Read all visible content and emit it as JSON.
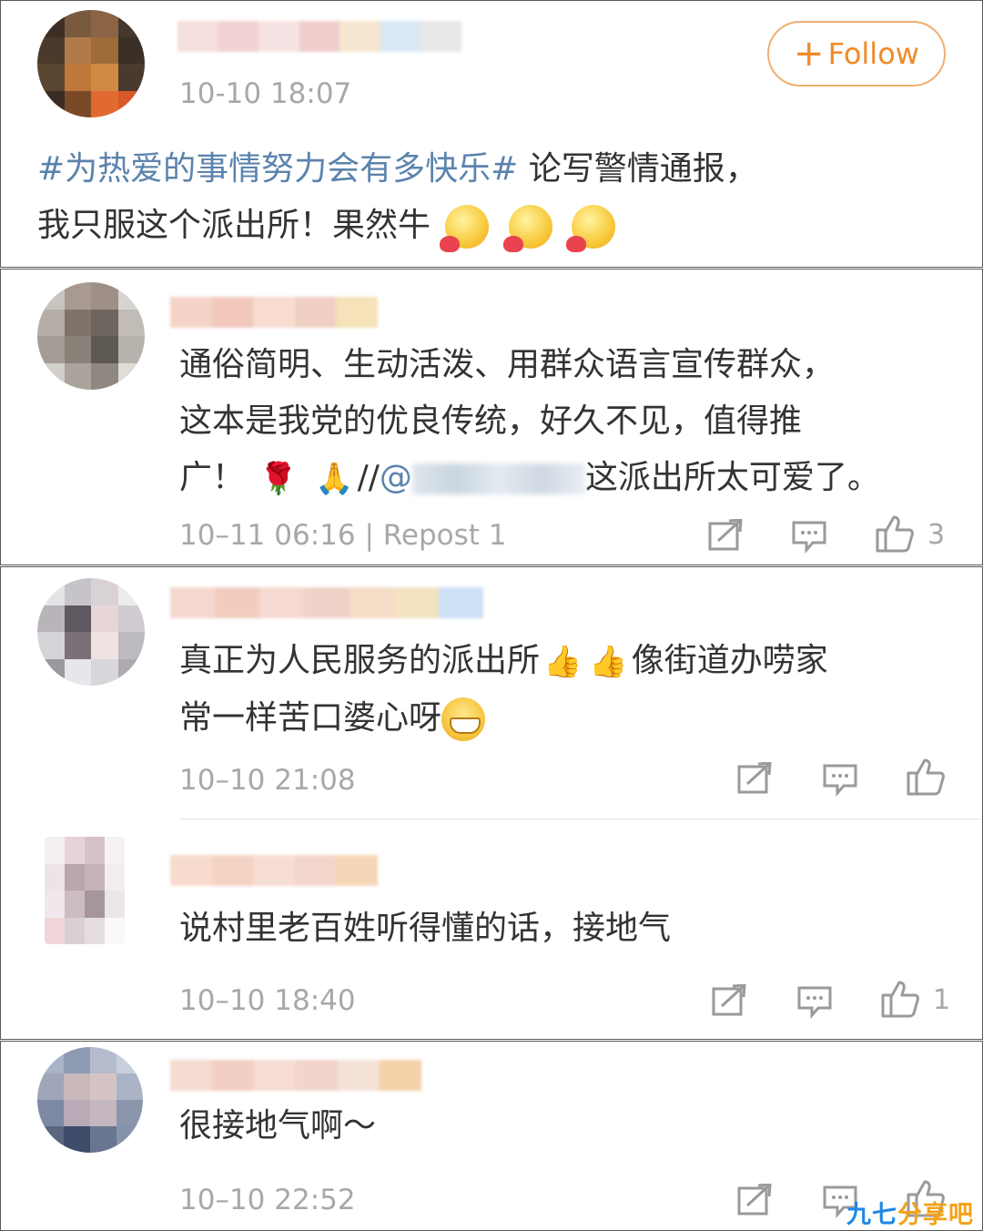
{
  "post": {
    "time": "10-10 18:07",
    "follow_plus": "+",
    "follow_label": "Follow",
    "topic": "#为热爱的事情努力会有多快乐#",
    "text_line1_rest": " 论写警情通报，",
    "text_line2": "我只服这个派出所！果然牛"
  },
  "comments": [
    {
      "line1": "通俗简明、生动活泼、用群众语言宣传群众，",
      "line2": "这本是我党的优良传统，好久不见，值得推",
      "line3_start": "广！",
      "line3_sep": "//",
      "mention_at": "@",
      "line3_end": "这派出所太可爱了。",
      "time": "10–11 06:16",
      "repost_label": "| Repost 1",
      "like_count": "3"
    },
    {
      "line1_start": "真正为人民服务的派出所",
      "line1_end": "像街道办唠家",
      "line2": "常一样苦口婆心呀",
      "time": "10–10 21:08",
      "like_count": ""
    },
    {
      "line1": "说村里老百姓听得懂的话，接地气",
      "time": "10–10 18:40",
      "like_count": "1"
    },
    {
      "line1": "很接地气啊～",
      "time": "10–10 22:52"
    }
  ],
  "icons": {
    "repost": "repost-icon",
    "comment": "comment-icon",
    "like": "thumbs-up-icon",
    "rose": "🌹",
    "thumb": "👍",
    "hands": "🙏"
  },
  "watermark": {
    "part1": "九七",
    "part2": "分享吧"
  },
  "colors": {
    "link": "#5b83ad",
    "follow": "#f08a2a",
    "meta": "#a8a8a8"
  }
}
